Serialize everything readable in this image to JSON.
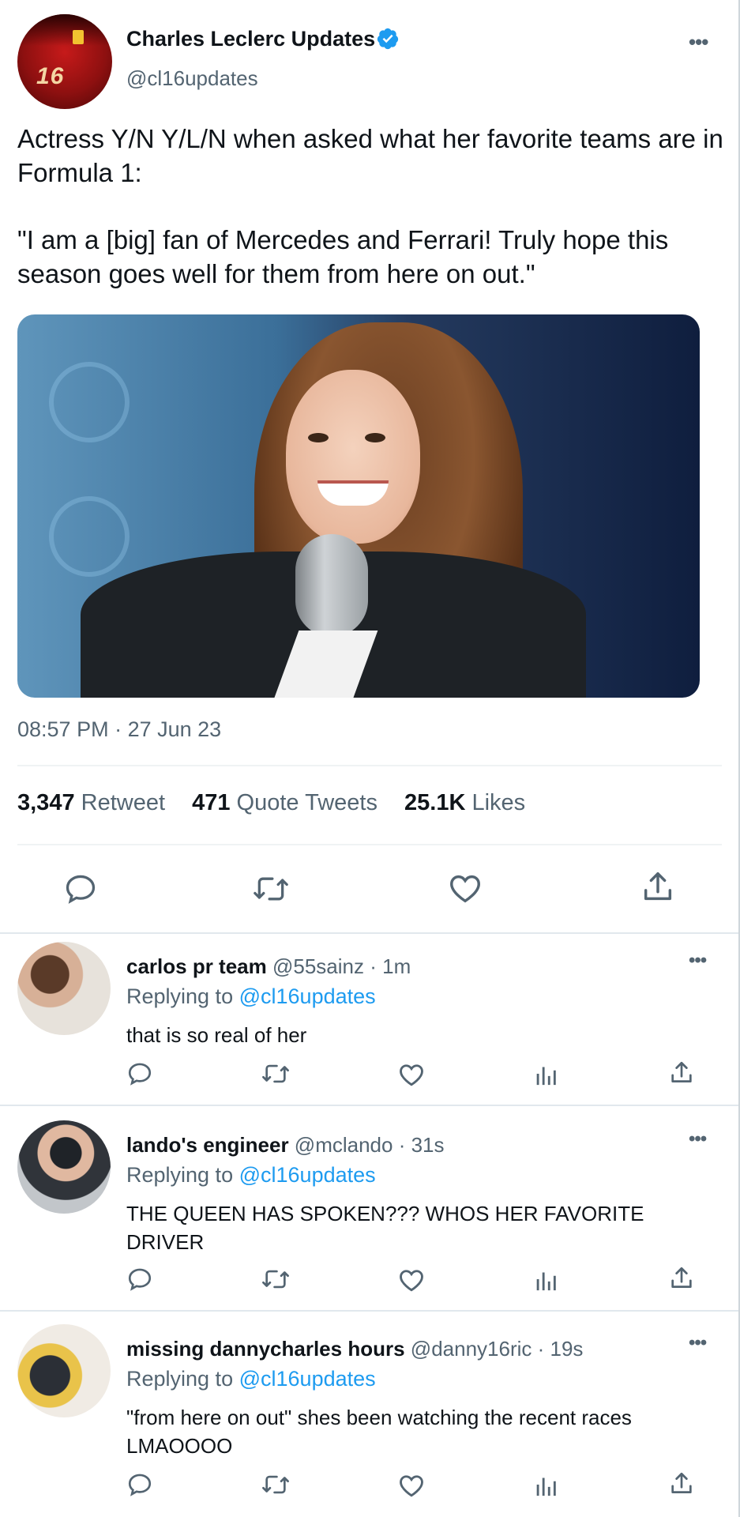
{
  "main_tweet": {
    "author_name": "Charles Leclerc Updates",
    "author_handle": "@cl16updates",
    "avatar_number": "16",
    "text_line1": "Actress Y/N Y/L/N when asked what her favorite teams are in Formula 1:",
    "text_line2": "\"I am a [big] fan of Mercedes and Ferrari! Truly hope this season goes well for them from here on out.\"",
    "time": "08:57 PM",
    "date": "27 Jun 23",
    "retweets_count": "3,347",
    "retweets_label": "Retweet",
    "quotes_count": "471",
    "quotes_label": "Quote Tweets",
    "likes_count": "25.1K",
    "likes_label": "Likes"
  },
  "replies": [
    {
      "name": "carlos pr team",
      "handle": "@55sainz",
      "age": "1m",
      "replying_label": "Replying to",
      "replying_to": "@cl16updates",
      "text": "that is so real of her"
    },
    {
      "name": "lando's engineer",
      "handle": "@mclando",
      "age": "31s",
      "replying_label": "Replying to",
      "replying_to": "@cl16updates",
      "text": "THE QUEEN HAS SPOKEN??? WHOS HER FAVORITE DRIVER"
    },
    {
      "name": "missing dannycharles hours",
      "handle": "@danny16ric",
      "age": "19s",
      "replying_label": "Replying to",
      "replying_to": "@cl16updates",
      "text": "\"from here on out\" shes been watching the recent races LMAOOOO"
    }
  ],
  "ui": {
    "more_glyph": "•••",
    "dot_sep": " · ",
    "verified_color": "#1d9bf0",
    "icon_color": "#536471"
  }
}
